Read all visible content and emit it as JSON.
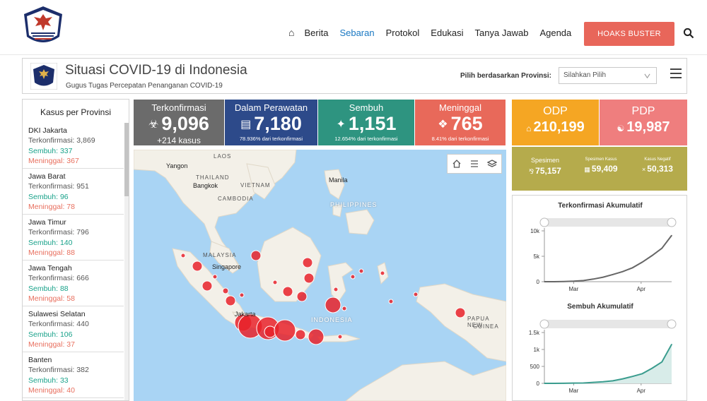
{
  "nav": {
    "home_icon": "home-icon",
    "items": [
      "Berita",
      "Sebaran",
      "Protokol",
      "Edukasi",
      "Tanya Jawab",
      "Agenda"
    ],
    "active": "Sebaran",
    "hoaks_label": "HOAKS BUSTER",
    "search_icon": "search-icon"
  },
  "header": {
    "title": "Situasi COVID-19 di Indonesia",
    "subtitle": "Gugus Tugas Percepatan Penanganan COVID-19",
    "province_label": "Pilih berdasarkan Provinsi:",
    "province_placeholder": "Silahkan Pilih"
  },
  "left_panel": {
    "title": "Kasus per Provinsi",
    "provinces": [
      {
        "name": "DKI Jakarta",
        "confirmed": "Terkonfirmasi: 3,869",
        "recovered": "Sembuh: 337",
        "deaths": "Meninggal: 367"
      },
      {
        "name": "Jawa Barat",
        "confirmed": "Terkonfirmasi: 951",
        "recovered": "Sembuh: 96",
        "deaths": "Meninggal: 78"
      },
      {
        "name": "Jawa Timur",
        "confirmed": "Terkonfirmasi: 796",
        "recovered": "Sembuh: 140",
        "deaths": "Meninggal: 88"
      },
      {
        "name": "Jawa Tengah",
        "confirmed": "Terkonfirmasi: 666",
        "recovered": "Sembuh: 88",
        "deaths": "Meninggal: 58"
      },
      {
        "name": "Sulawesi Selatan",
        "confirmed": "Terkonfirmasi: 440",
        "recovered": "Sembuh: 106",
        "deaths": "Meninggal: 37"
      },
      {
        "name": "Banten",
        "confirmed": "Terkonfirmasi: 382",
        "recovered": "Sembuh: 33",
        "deaths": "Meninggal: 40"
      }
    ]
  },
  "stats": {
    "confirmed": {
      "label": "Terkonfirmasi",
      "value": "9,096",
      "sub": "+214 kasus"
    },
    "in_care": {
      "label": "Dalam Perawatan",
      "value": "7,180",
      "sub": "78.936% dari terkonfirmasi"
    },
    "recovered": {
      "label": "Sembuh",
      "value": "1,151",
      "sub": "12.654% dari terkonfirmasi"
    },
    "deaths": {
      "label": "Meninggal",
      "value": "765",
      "sub": "8.41% dari terkonfirmasi"
    }
  },
  "side_stats": {
    "odp": {
      "label": "ODP",
      "value": "210,199"
    },
    "pdp": {
      "label": "PDP",
      "value": "19,987"
    },
    "specimen": {
      "label": "Spesimen",
      "value": "75,157"
    },
    "specimen_cases": {
      "label": "Spesimen Kasus",
      "value": "59,409"
    },
    "negative": {
      "label": "Kasus Negatif",
      "value": "50,313"
    }
  },
  "map": {
    "labels": {
      "laos": "LAOS",
      "yangon": "Yangon",
      "thailand": "THAILAND",
      "bangkok": "Bangkok",
      "vietnam": "VIETNAM",
      "cambodia": "CAMBODIA",
      "manila": "Manila",
      "philippines": "PHILIPPINES",
      "malaysia": "MALAYSIA",
      "singapore": "Singapore",
      "jakarta": "Jakarta",
      "indonesia": "INDONESIA",
      "png": "PAPUA NEW",
      "guinea": "GUINEA"
    }
  },
  "colors": {
    "accent": "#1a78c2",
    "hoaks": "#e8665a",
    "confirmed": "#6b6b6b",
    "in_care": "#2d4a8a",
    "recovered": "#2e9480",
    "deaths": "#e8695a",
    "odp": "#f5a623",
    "pdp": "#ef7e7e",
    "specimen": "#b5ab4c",
    "bubble": "#e8222a",
    "sea": "#a9d4f4"
  },
  "chart_data": [
    {
      "type": "area",
      "title": "Terkonfirmasi Akumulatif",
      "x": [
        "Mar 02",
        "Mar 06",
        "Mar 10",
        "Mar 14",
        "Mar 18",
        "Mar 22",
        "Mar 26",
        "Mar 30",
        "Apr 03",
        "Apr 07",
        "Apr 11",
        "Apr 15",
        "Apr 19",
        "Apr 22"
      ],
      "x_ticks": [
        "Mar",
        "Apr"
      ],
      "y_ticks": [
        "0",
        "5k",
        "10k"
      ],
      "ylim": [
        0,
        10000
      ],
      "series": [
        {
          "values": [
            2,
            4,
            27,
            96,
            227,
            514,
            893,
            1414,
            1986,
            2738,
            3842,
            5136,
            6575,
            9096
          ]
        }
      ]
    },
    {
      "type": "area",
      "title": "Sembuh Akumulatif",
      "x": [
        "Mar 02",
        "Mar 06",
        "Mar 10",
        "Mar 14",
        "Mar 18",
        "Mar 22",
        "Mar 26",
        "Mar 30",
        "Apr 03",
        "Apr 07",
        "Apr 11",
        "Apr 15",
        "Apr 19",
        "Apr 22"
      ],
      "x_ticks": [
        "Mar",
        "Apr"
      ],
      "y_ticks": [
        "0",
        "500",
        "1k",
        "1.5k"
      ],
      "ylim": [
        0,
        1500
      ],
      "series": [
        {
          "values": [
            0,
            0,
            2,
            8,
            11,
            29,
            46,
            75,
            134,
            204,
            286,
            446,
            631,
            1151
          ]
        }
      ]
    }
  ]
}
